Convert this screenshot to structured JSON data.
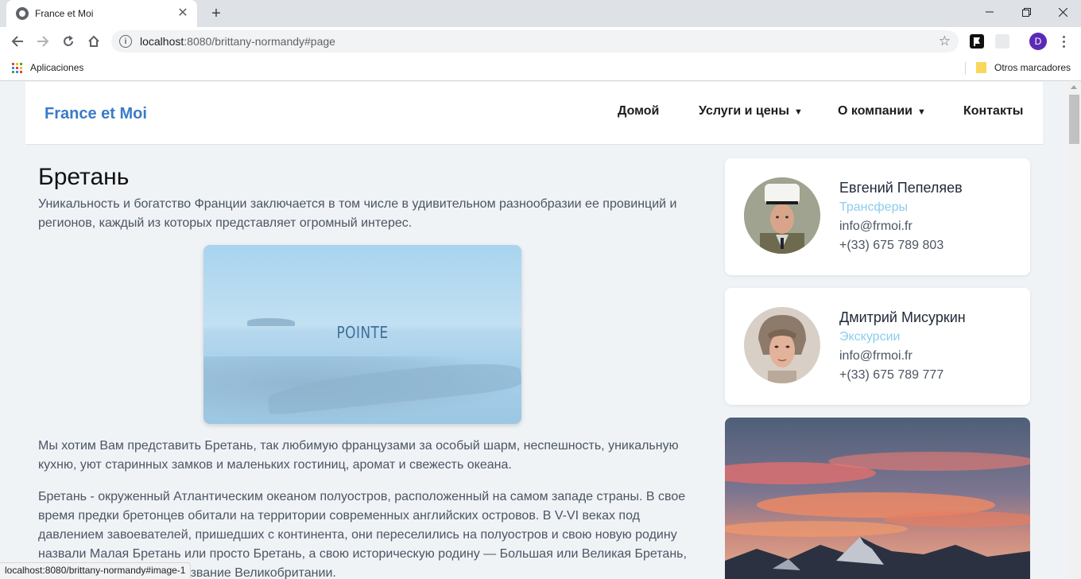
{
  "browser": {
    "tab_title": "France et Moi",
    "url_host": "localhost",
    "url_path": ":8080/brittany-normandy#page",
    "bookmarks_apps": "Aplicaciones",
    "bookmarks_other": "Otros marcadores",
    "profile_initial": "D",
    "status_url": "localhost:8080/brittany-normandy#image-1"
  },
  "site": {
    "logo": "France et Moi",
    "nav": {
      "home": "Домой",
      "services": "Услуги и цены",
      "about": "О компании",
      "contacts": "Контакты"
    }
  },
  "article": {
    "title": "Бретань",
    "intro": "Уникальность и богатство Франции заключается в том числе в удивительном разнообразии ее провинций и регионов, каждый из которых представляет огромный интерес.",
    "image_caption": "POINTE",
    "para1": "Мы хотим Вам представить Бретань, так любимую французами за особый шарм, неспешность, уникальную кухню, уют старинных замков и маленьких гостиниц, аромат и свежесть океана.",
    "para2": "Бретань - окруженный Атлантическим океаном полуостров, расположенный на самом западе страны. В свое время предки бретонцев обитали на территории современных английских островов. В V-VI веках под давлением завоевателей, пришедших с континента, они переселились на полуостров и свою новую родину назвали Малая Бретань или просто Бретань, а свою историческую родину — Большая или Великая Бретань, ныне это современное название Великобритании."
  },
  "contacts": [
    {
      "name": "Евгений Пепеляев",
      "role": "Трансферы",
      "email": "info@frmoi.fr",
      "phone": "+(33) 675 789 803"
    },
    {
      "name": "Дмитрий Мисуркин",
      "role": "Экскурсии",
      "email": "info@frmoi.fr",
      "phone": "+(33) 675 789 777"
    }
  ],
  "colors": {
    "logo": "#3a7bc8",
    "role_link": "#8ccdee",
    "page_bg": "#f0f3f6"
  }
}
